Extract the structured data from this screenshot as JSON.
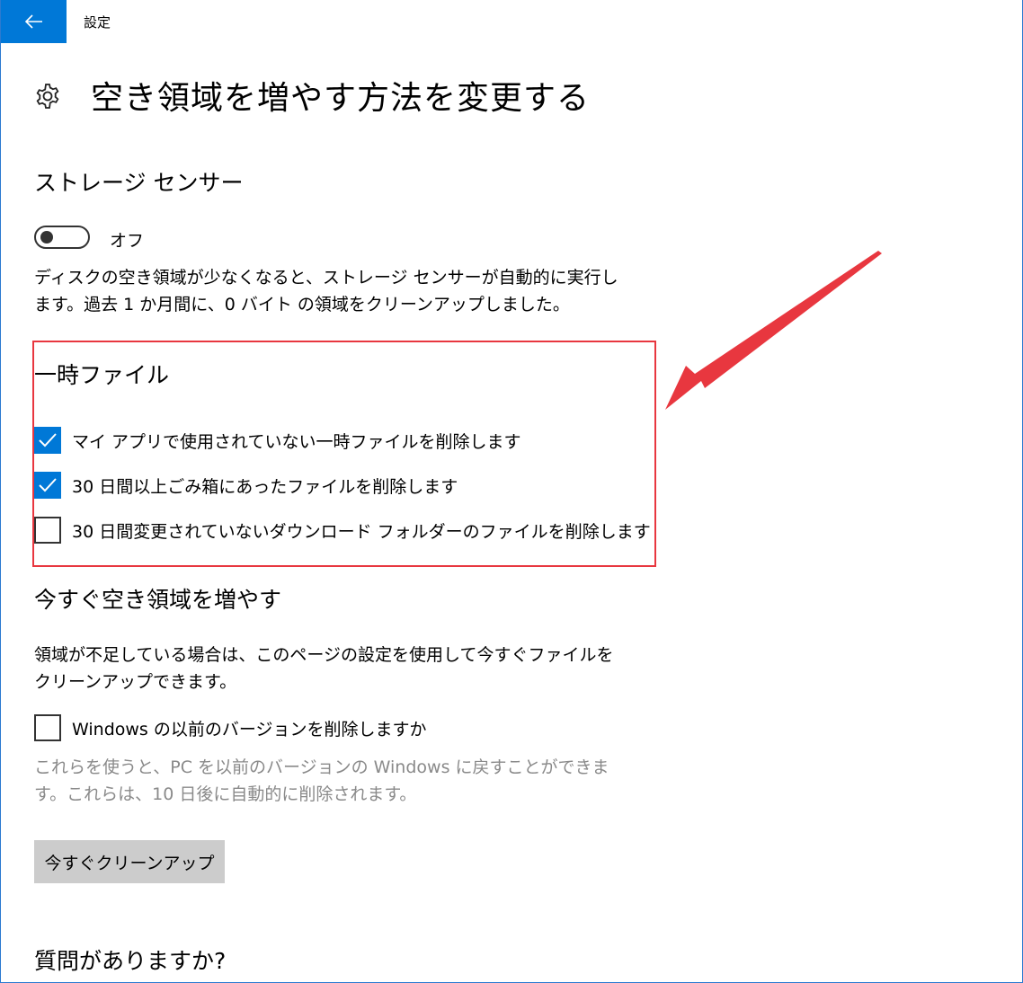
{
  "header": {
    "back_icon": "back-arrow-icon",
    "app_title": "設定",
    "accent_color": "#0078d7"
  },
  "page": {
    "icon": "gear-icon",
    "title": "空き領域を増やす方法を変更する"
  },
  "storage_sense": {
    "heading": "ストレージ センサー",
    "toggle_state": "オフ",
    "description": "ディスクの空き領域が少なくなると、ストレージ センサーが自動的に実行します。過去 1 か月間に、0 バイト の領域をクリーンアップしました。"
  },
  "temp_files": {
    "heading": "一時ファイル",
    "options": [
      {
        "label": "マイ アプリで使用されていない一時ファイルを削除します",
        "checked": true
      },
      {
        "label": "30 日間以上ごみ箱にあったファイルを削除します",
        "checked": true
      },
      {
        "label": "30 日間変更されていないダウンロード フォルダーのファイルを削除します",
        "checked": false
      }
    ],
    "annotation_color": "#e8373f"
  },
  "free_up_now": {
    "heading": "今すぐ空き領域を増やす",
    "description": "領域が不足している場合は、このページの設定を使用して今すぐファイルをクリーンアップできます。",
    "previous_windows": {
      "label": "Windows の以前のバージョンを削除しますか",
      "checked": false,
      "help": "これらを使うと、PC を以前のバージョンの Windows に戻すことができます。これらは、10 日後に自動的に削除されます。"
    },
    "button_label": "今すぐクリーンアップ"
  },
  "questions": {
    "heading": "質問がありますか?"
  }
}
